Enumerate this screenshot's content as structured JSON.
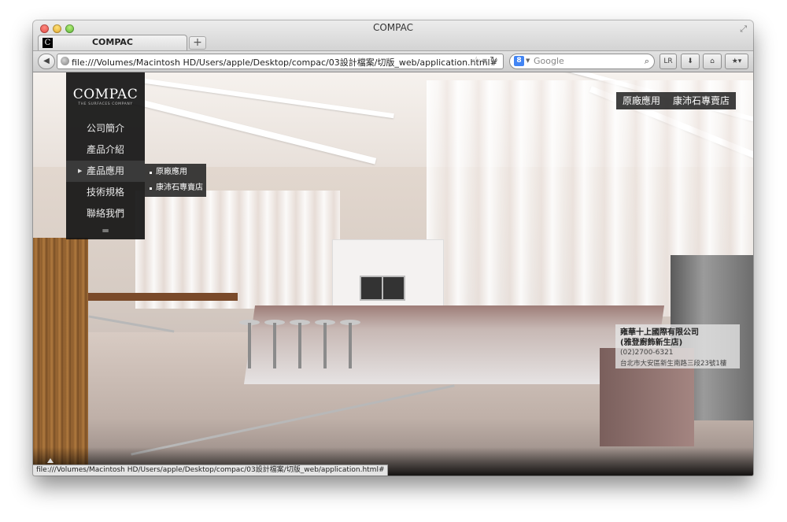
{
  "window": {
    "title": "COMPAC",
    "tab_title": "COMPAC",
    "tab_favicon": "C",
    "new_tab": "+"
  },
  "toolbar": {
    "url": "file:///Volumes/Macintosh HD/Users/apple/Desktop/compac/03設計檔案/切版_web/application.html#",
    "search_engine": "8",
    "search_placeholder": "Google",
    "btn_lr": "LR"
  },
  "site": {
    "logo": "COMPAC",
    "tagline": "THE SURFACES COMPANY",
    "nav": [
      {
        "label": "公司簡介"
      },
      {
        "label": "產品介紹"
      },
      {
        "label": "產品應用"
      },
      {
        "label": "技術規格"
      },
      {
        "label": "聯絡我們"
      }
    ],
    "submenu": [
      {
        "label": "原廠應用"
      },
      {
        "label": "康沛石專賣店"
      }
    ],
    "top_links": [
      {
        "label": "原廠應用"
      },
      {
        "label": "康沛石專賣店"
      }
    ],
    "info": {
      "name_line1": "雍華十上國際有限公司",
      "name_line2": "(雅登廚飾新生店)",
      "phone": "(02)2700-6321",
      "address": "台北市大安區新生南路三段23號1樓"
    }
  },
  "statusbar": {
    "text": "file:///Volumes/Macintosh HD/Users/apple/Desktop/compac/03設計檔案/切版_web/application.html#"
  },
  "icons": [
    "close-icon",
    "minimize-icon",
    "zoom-icon",
    "fullscreen-icon",
    "back-arrow-icon",
    "globe-icon",
    "bookmark-star-icon",
    "reload-icon",
    "google-icon",
    "magnifier-icon",
    "download-icon",
    "home-icon",
    "bookmarks-icon",
    "menu-icon",
    "submenu-arrow-icon",
    "scroll-up-icon"
  ]
}
